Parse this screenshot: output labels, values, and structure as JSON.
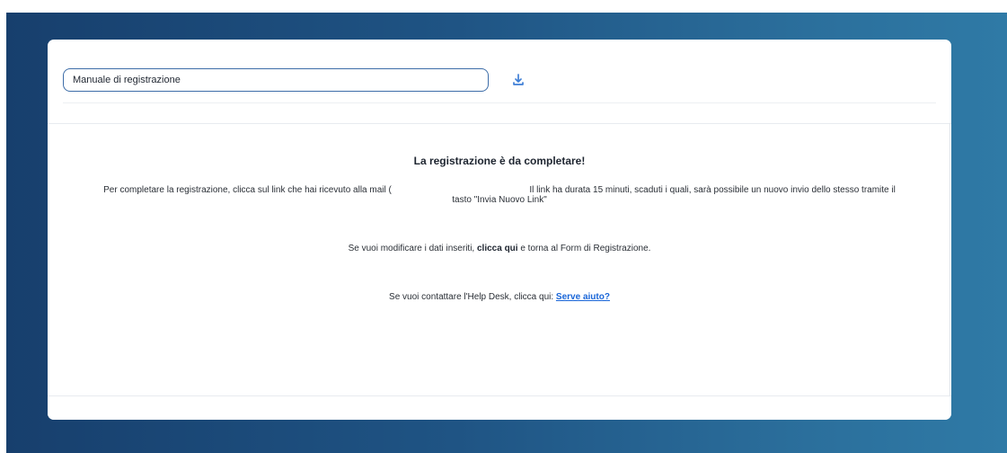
{
  "toolbar": {
    "manual_value": "Manuale di registrazione",
    "download_icon": "download-icon"
  },
  "message": {
    "title": "La registrazione è da completare!",
    "text_before_mail": "Per completare la registrazione, clicca sul link che hai ricevuto alla mail (",
    "text_after_mail": "Il link ha durata 15 minuti, scaduti i quali, sarà possibile un nuovo invio dello stesso tramite il tasto \"Invia Nuovo Link\"",
    "modify_before": "Se vuoi modificare i dati inseriti,",
    "modify_link": "clicca qui",
    "modify_after": "e torna al Form di Registrazione.",
    "help_text": "Se vuoi contattare l'Help Desk, clicca qui:",
    "help_link": "Serve aiuto?"
  },
  "colors": {
    "background_start": "#173f6d",
    "background_end": "#2f7aa6",
    "accent": "#1a66d8"
  }
}
